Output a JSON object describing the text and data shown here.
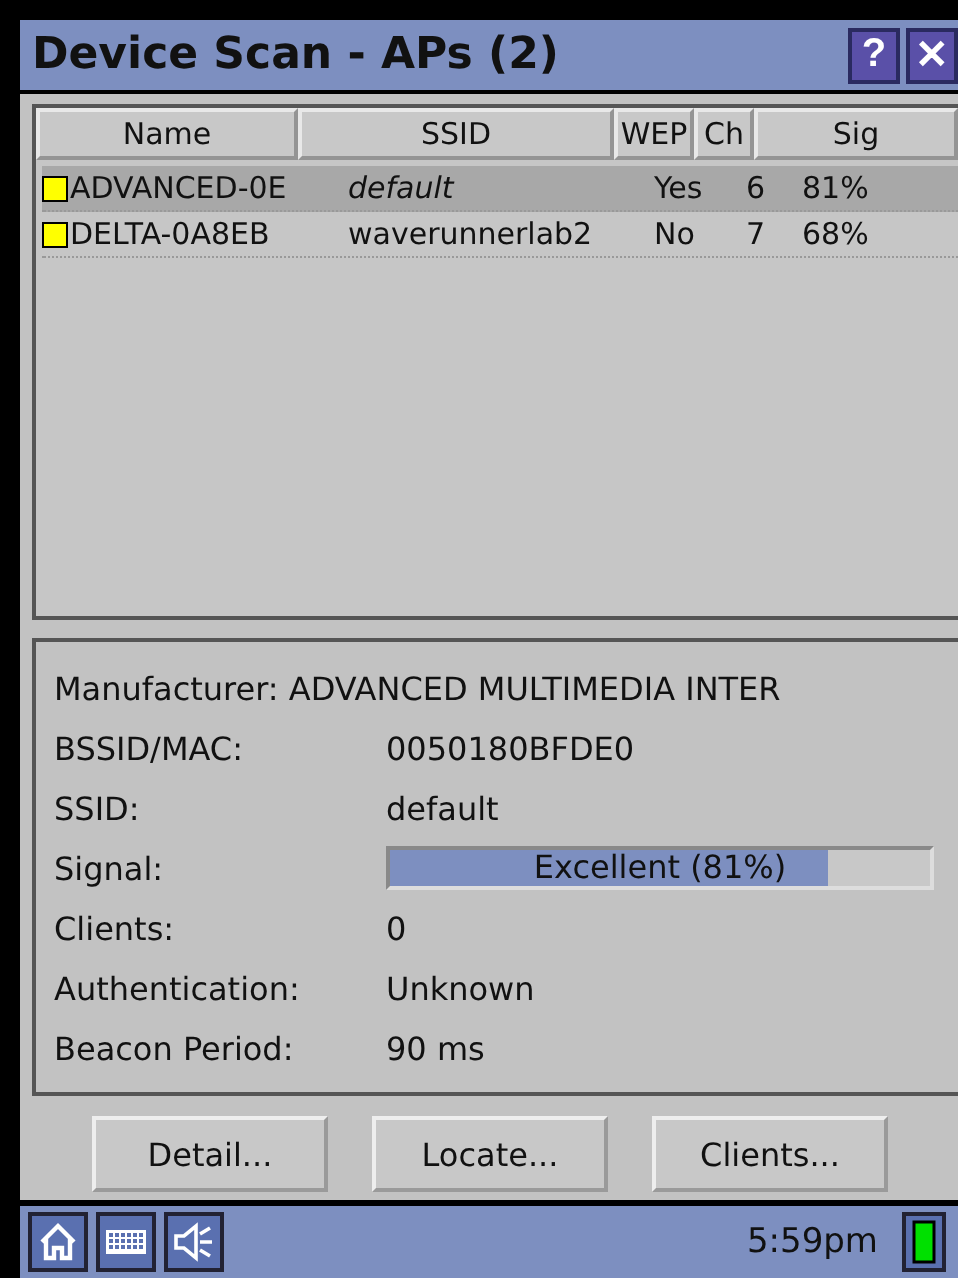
{
  "window": {
    "title": "Device Scan - APs (2)",
    "help": "?",
    "close": "✕"
  },
  "table": {
    "columns": [
      "Name",
      "SSID",
      "WEP",
      "Ch",
      "Sig"
    ],
    "rows": [
      {
        "name": "ADVANCED-0E",
        "ssid": "default",
        "ssid_italic": true,
        "wep": "Yes",
        "ch": "6",
        "sig": "81%",
        "color": "#ffff00",
        "selected": true
      },
      {
        "name": "DELTA-0A8EB",
        "ssid": "waverunnerlab2",
        "ssid_italic": false,
        "wep": "No",
        "ch": "7",
        "sig": "68%",
        "color": "#ffff00",
        "selected": false
      }
    ]
  },
  "details": [
    {
      "kind": "wide",
      "label": "Manufacturer:",
      "value": "ADVANCED MULTIMEDIA INTER"
    },
    {
      "kind": "text",
      "label": "BSSID/MAC:",
      "value": "0050180BFDE0"
    },
    {
      "kind": "text",
      "label": "SSID:",
      "value": "default"
    },
    {
      "kind": "meter",
      "label": "Signal:",
      "value": "Excellent (81%)",
      "level": 0.81
    },
    {
      "kind": "text",
      "label": "Clients:",
      "value": "0"
    },
    {
      "kind": "text",
      "label": "Authentication:",
      "value": "Unknown"
    },
    {
      "kind": "text",
      "label": "Beacon Period:",
      "value": "90 ms"
    }
  ],
  "buttons": [
    "Detail...",
    "Locate...",
    "Clients..."
  ],
  "taskbar": {
    "time": "5:59pm"
  }
}
